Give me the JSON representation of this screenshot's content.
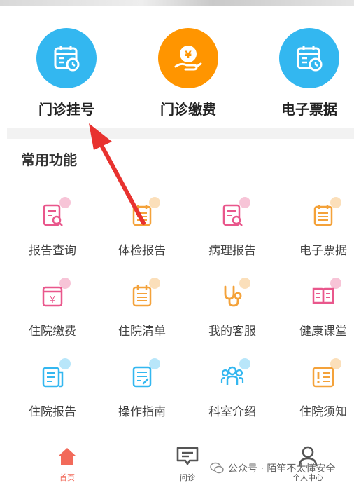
{
  "quick_actions": [
    {
      "label": "门诊挂号",
      "icon": "calendar-clock-icon",
      "color": "#33b7f0"
    },
    {
      "label": "门诊缴费",
      "icon": "yuan-hand-icon",
      "color": "#ff9500"
    },
    {
      "label": "电子票据",
      "icon": "calendar-clock-icon",
      "color": "#33b7f0"
    }
  ],
  "section": {
    "title": "常用功能"
  },
  "functions": [
    {
      "label": "报告查询",
      "icon": "report-search-icon",
      "color": "#e9578c"
    },
    {
      "label": "体检报告",
      "icon": "checklist-icon",
      "color": "#f4a23a"
    },
    {
      "label": "病理报告",
      "icon": "report-search-icon",
      "color": "#e9578c"
    },
    {
      "label": "电子票据",
      "icon": "checklist-icon",
      "color": "#f4a23a"
    },
    {
      "label": "住院缴费",
      "icon": "yuan-card-icon",
      "color": "#e9578c"
    },
    {
      "label": "住院清单",
      "icon": "checklist-icon",
      "color": "#f4a23a"
    },
    {
      "label": "我的客服",
      "icon": "stethoscope-icon",
      "color": "#f4a23a"
    },
    {
      "label": "健康课堂",
      "icon": "book-icon",
      "color": "#e9578c"
    },
    {
      "label": "住院报告",
      "icon": "document-icon",
      "color": "#33b7f0"
    },
    {
      "label": "操作指南",
      "icon": "guide-icon",
      "color": "#33b7f0"
    },
    {
      "label": "科室介绍",
      "icon": "group-icon",
      "color": "#33b7f0"
    },
    {
      "label": "住院须知",
      "icon": "notice-icon",
      "color": "#f4a23a"
    }
  ],
  "tabbar": [
    {
      "label": "首页",
      "icon": "home-icon",
      "active": true
    },
    {
      "label": "问诊",
      "icon": "chat-icon",
      "active": false
    },
    {
      "label": "个人中心",
      "icon": "user-icon",
      "active": false
    }
  ],
  "watermark": {
    "text": "公众号 · 陌笙不太懂安全",
    "icon": "wechat-icon"
  },
  "colors": {
    "accent_red": "#e8322f",
    "tab_active": "#f26a5a"
  }
}
